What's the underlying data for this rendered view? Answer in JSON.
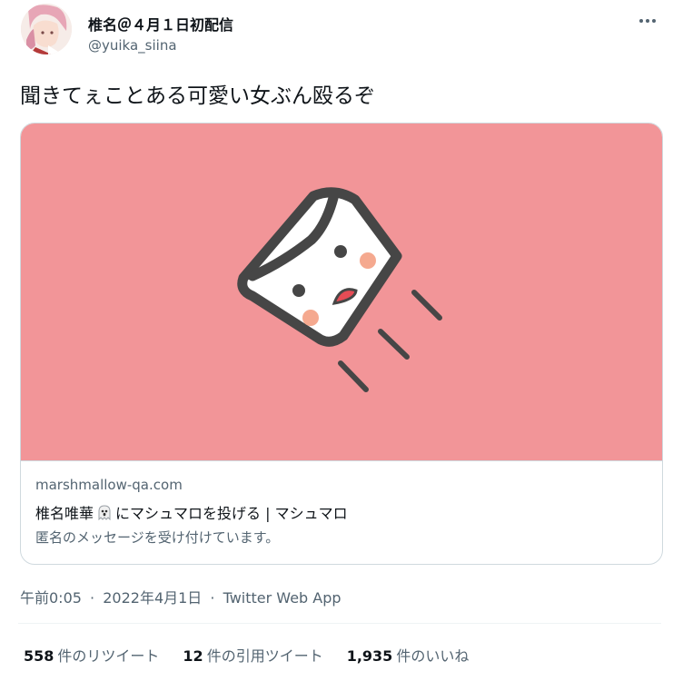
{
  "user": {
    "display_name": "椎名＠４月１日初配信",
    "handle": "@yuika_siina"
  },
  "tweet": {
    "text": "聞きてぇことある可愛い女ぶん殴るぞ"
  },
  "card": {
    "domain": "marshmallow-qa.com",
    "title_prefix": "椎名唯華",
    "title_suffix": "にマシュマロを投げる | マシュマロ",
    "description": "匿名のメッセージを受け付けています。",
    "image_bg_color": "#f29598"
  },
  "meta": {
    "time": "午前0:05",
    "separator": "·",
    "date": "2022年4月1日",
    "source": "Twitter Web App"
  },
  "stats": {
    "retweets_count": "558",
    "retweets_label": "件のリツイート",
    "quotes_count": "12",
    "quotes_label": "件の引用ツイート",
    "likes_count": "1,935",
    "likes_label": "件のいいね"
  },
  "icons": {
    "more": "more-horizontal-icon",
    "ghost": "ghost-emoji-icon",
    "marshmallow": "marshmallow-illustration"
  }
}
